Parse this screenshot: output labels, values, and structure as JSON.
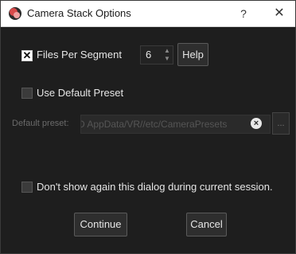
{
  "window": {
    "title": "Camera Stack Options",
    "help_glyph": "?",
    "close_glyph": "✕"
  },
  "files_per_segment": {
    "label": "Files Per Segment",
    "checked": true,
    "value": "6",
    "help_label": "Help"
  },
  "use_default_preset": {
    "label": "Use Default Preset",
    "checked": false
  },
  "preset": {
    "label": "Default preset:",
    "path": "D AppData/VR//etc/CameraPresets",
    "browse_label": "..."
  },
  "dont_show": {
    "label": "Don't show again this dialog during current session.",
    "checked": false
  },
  "buttons": {
    "continue": "Continue",
    "cancel": "Cancel"
  },
  "icons": {
    "app": "camera-app-icon",
    "help": "question-icon",
    "close": "close-icon",
    "clear": "clear-icon"
  },
  "colors": {
    "background": "#1e1e1e",
    "titlebar": "#ffffff",
    "button_bg": "#2e2e2e",
    "text": "#e6e6e6"
  }
}
